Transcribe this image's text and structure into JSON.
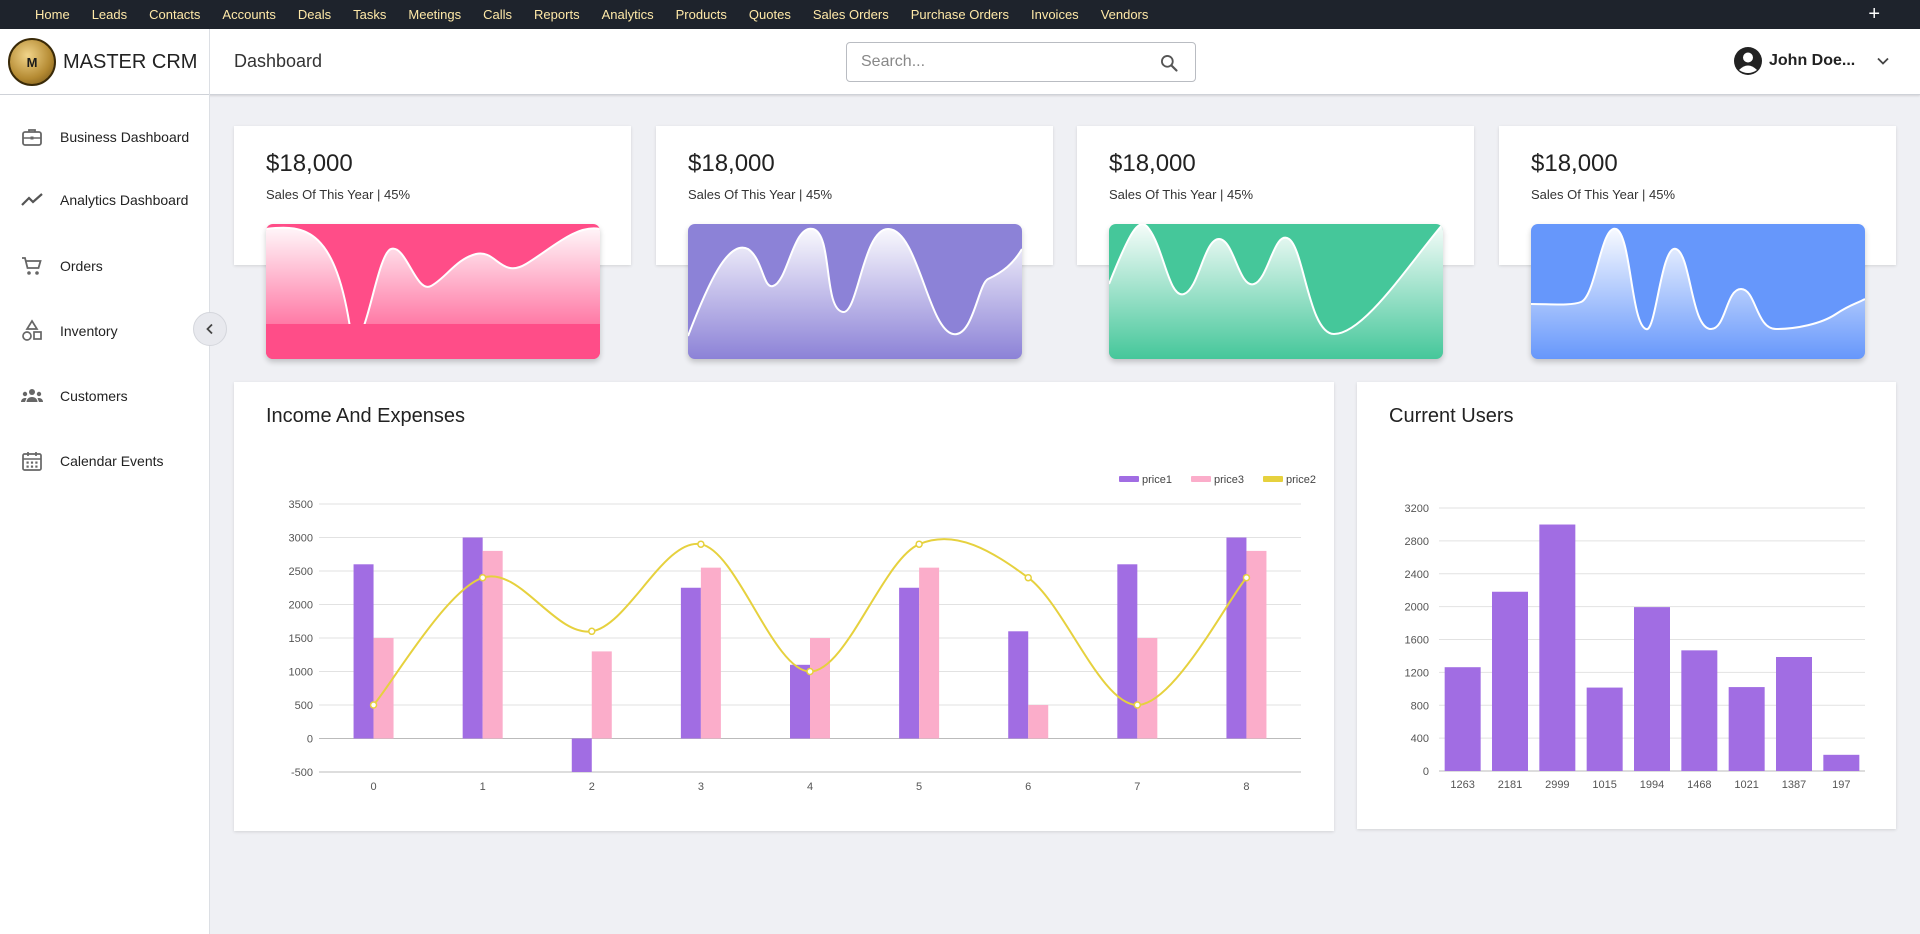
{
  "topnav": {
    "links": [
      "Home",
      "Leads",
      "Contacts",
      "Accounts",
      "Deals",
      "Tasks",
      "Meetings",
      "Calls",
      "Reports",
      "Analytics",
      "Products",
      "Quotes",
      "Sales Orders",
      "Purchase Orders",
      "Invoices",
      "Vendors"
    ],
    "plus_label": "+"
  },
  "header": {
    "logo_letter": "M",
    "brand": "MASTER CRM",
    "page_title": "Dashboard",
    "search_placeholder": "Search...",
    "user_name": "John Doe..."
  },
  "sidebar": {
    "items": [
      {
        "label": "Business Dashboard",
        "icon": "briefcase-icon"
      },
      {
        "label": "Analytics Dashboard",
        "icon": "trending-up-icon"
      },
      {
        "label": "Orders",
        "icon": "cart-icon"
      },
      {
        "label": "Inventory",
        "icon": "shapes-icon"
      },
      {
        "label": "Customers",
        "icon": "people-icon"
      },
      {
        "label": "Calendar Events",
        "icon": "calendar-icon"
      }
    ]
  },
  "stats": [
    {
      "amount": "$18,000",
      "subtitle": "Sales Of This Year | 45%",
      "color": "#ff4d88"
    },
    {
      "amount": "$18,000",
      "subtitle": "Sales Of This Year | 45%",
      "color": "#8c82d7"
    },
    {
      "amount": "$18,000",
      "subtitle": "Sales Of This Year | 45%",
      "color": "#45c79a"
    },
    {
      "amount": "$18,000",
      "subtitle": "Sales Of This Year | 45%",
      "color": "#6697fb"
    }
  ],
  "chart_data": [
    {
      "type": "bar",
      "title": "Income And Expenses",
      "categories": [
        "0",
        "1",
        "2",
        "3",
        "4",
        "5",
        "6",
        "7",
        "8"
      ],
      "series": [
        {
          "name": "price1",
          "type": "bar",
          "color": "#a16de3",
          "values": [
            2600,
            3000,
            -500,
            2250,
            1100,
            2250,
            1600,
            2600,
            3000
          ]
        },
        {
          "name": "price3",
          "type": "bar",
          "color": "#fbadca",
          "values": [
            1500,
            2800,
            1300,
            2550,
            1500,
            2550,
            500,
            1500,
            2800
          ]
        },
        {
          "name": "price2",
          "type": "line",
          "color": "#e6d13e",
          "values": [
            500,
            2400,
            1600,
            2900,
            1000,
            2900,
            2400,
            500,
            2400
          ]
        }
      ],
      "legend_order": [
        "price1",
        "price3",
        "price2"
      ],
      "yticks": [
        3500,
        3000,
        2500,
        2000,
        1500,
        1000,
        500,
        0,
        -500
      ],
      "ylim": [
        -500,
        3500
      ],
      "legend": "top-right",
      "grid": true
    },
    {
      "type": "bar",
      "title": "Current Users",
      "categories": [
        "1263",
        "2181",
        "2999",
        "1015",
        "1994",
        "1468",
        "1021",
        "1387",
        "197"
      ],
      "values": [
        1263,
        2181,
        2999,
        1015,
        1994,
        1468,
        1021,
        1387,
        197
      ],
      "color": "#a16de3",
      "yticks": [
        3200,
        2800,
        2400,
        2000,
        1600,
        1200,
        800,
        400,
        0
      ],
      "ylim": [
        0,
        3200
      ],
      "grid": true
    }
  ]
}
